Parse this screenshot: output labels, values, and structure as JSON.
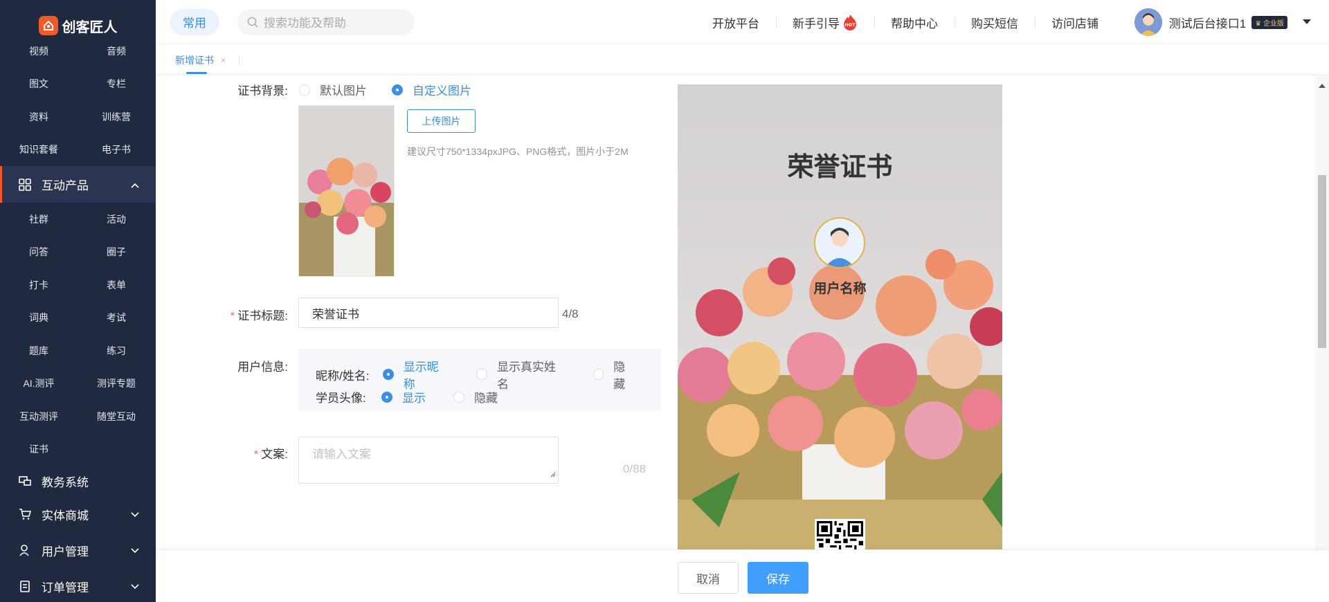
{
  "app": {
    "name": "创客匠人"
  },
  "sidebar": {
    "top_items": [
      "视频",
      "音频",
      "图文",
      "专栏",
      "资料",
      "训练营",
      "知识套餐",
      "电子书"
    ],
    "interactive_group": {
      "label": "互动产品"
    },
    "interactive_items": [
      "社群",
      "活动",
      "问答",
      "圈子",
      "打卡",
      "表单",
      "词典",
      "考试",
      "题库",
      "练习",
      "AI.测评",
      "测评专题",
      "互动测评",
      "随堂互动",
      "证书"
    ],
    "groups": [
      {
        "label": "教务系统",
        "icon": "desktop-icon"
      },
      {
        "label": "实体商城",
        "icon": "cart-icon"
      },
      {
        "label": "用户管理",
        "icon": "user-icon"
      },
      {
        "label": "订单管理",
        "icon": "order-icon"
      }
    ]
  },
  "topbar": {
    "common_label": "常用",
    "search_placeholder": "搜索功能及帮助",
    "nav": [
      "开放平台",
      "新手引导",
      "帮助中心",
      "购买短信",
      "访问店铺"
    ],
    "hot_label": "HOT",
    "user_name": "测试后台接口1",
    "badge": "企业版"
  },
  "tabs": [
    {
      "label": "新增证书",
      "close": "×"
    }
  ],
  "form": {
    "background": {
      "label": "证书背景:",
      "options": [
        "默认图片",
        "自定义图片"
      ],
      "selected": "自定义图片",
      "upload_label": "上传图片",
      "hint": "建议尺寸750*1334pxJPG、PNG格式，图片小于2M"
    },
    "title": {
      "required": "*",
      "label": "证书标题:",
      "value": "荣誉证书",
      "count": "4/8"
    },
    "user_info": {
      "label": "用户信息:",
      "name_label": "昵称/姓名:",
      "name_options": [
        "显示昵称",
        "显示真实姓名",
        "隐藏"
      ],
      "name_selected": "显示昵称",
      "avatar_label": "学员头像:",
      "avatar_options": [
        "显示",
        "隐藏"
      ],
      "avatar_selected": "显示"
    },
    "copy": {
      "required": "*",
      "label": "文案:",
      "placeholder": "请输入文案",
      "count": "0/88"
    }
  },
  "preview": {
    "title": "荣誉证书",
    "user_name": "用户名称"
  },
  "footer": {
    "cancel": "取消",
    "save": "保存"
  },
  "colors": {
    "sidebar_bg": "#1f2940",
    "accent": "#f05a28",
    "primary": "#409eff"
  }
}
